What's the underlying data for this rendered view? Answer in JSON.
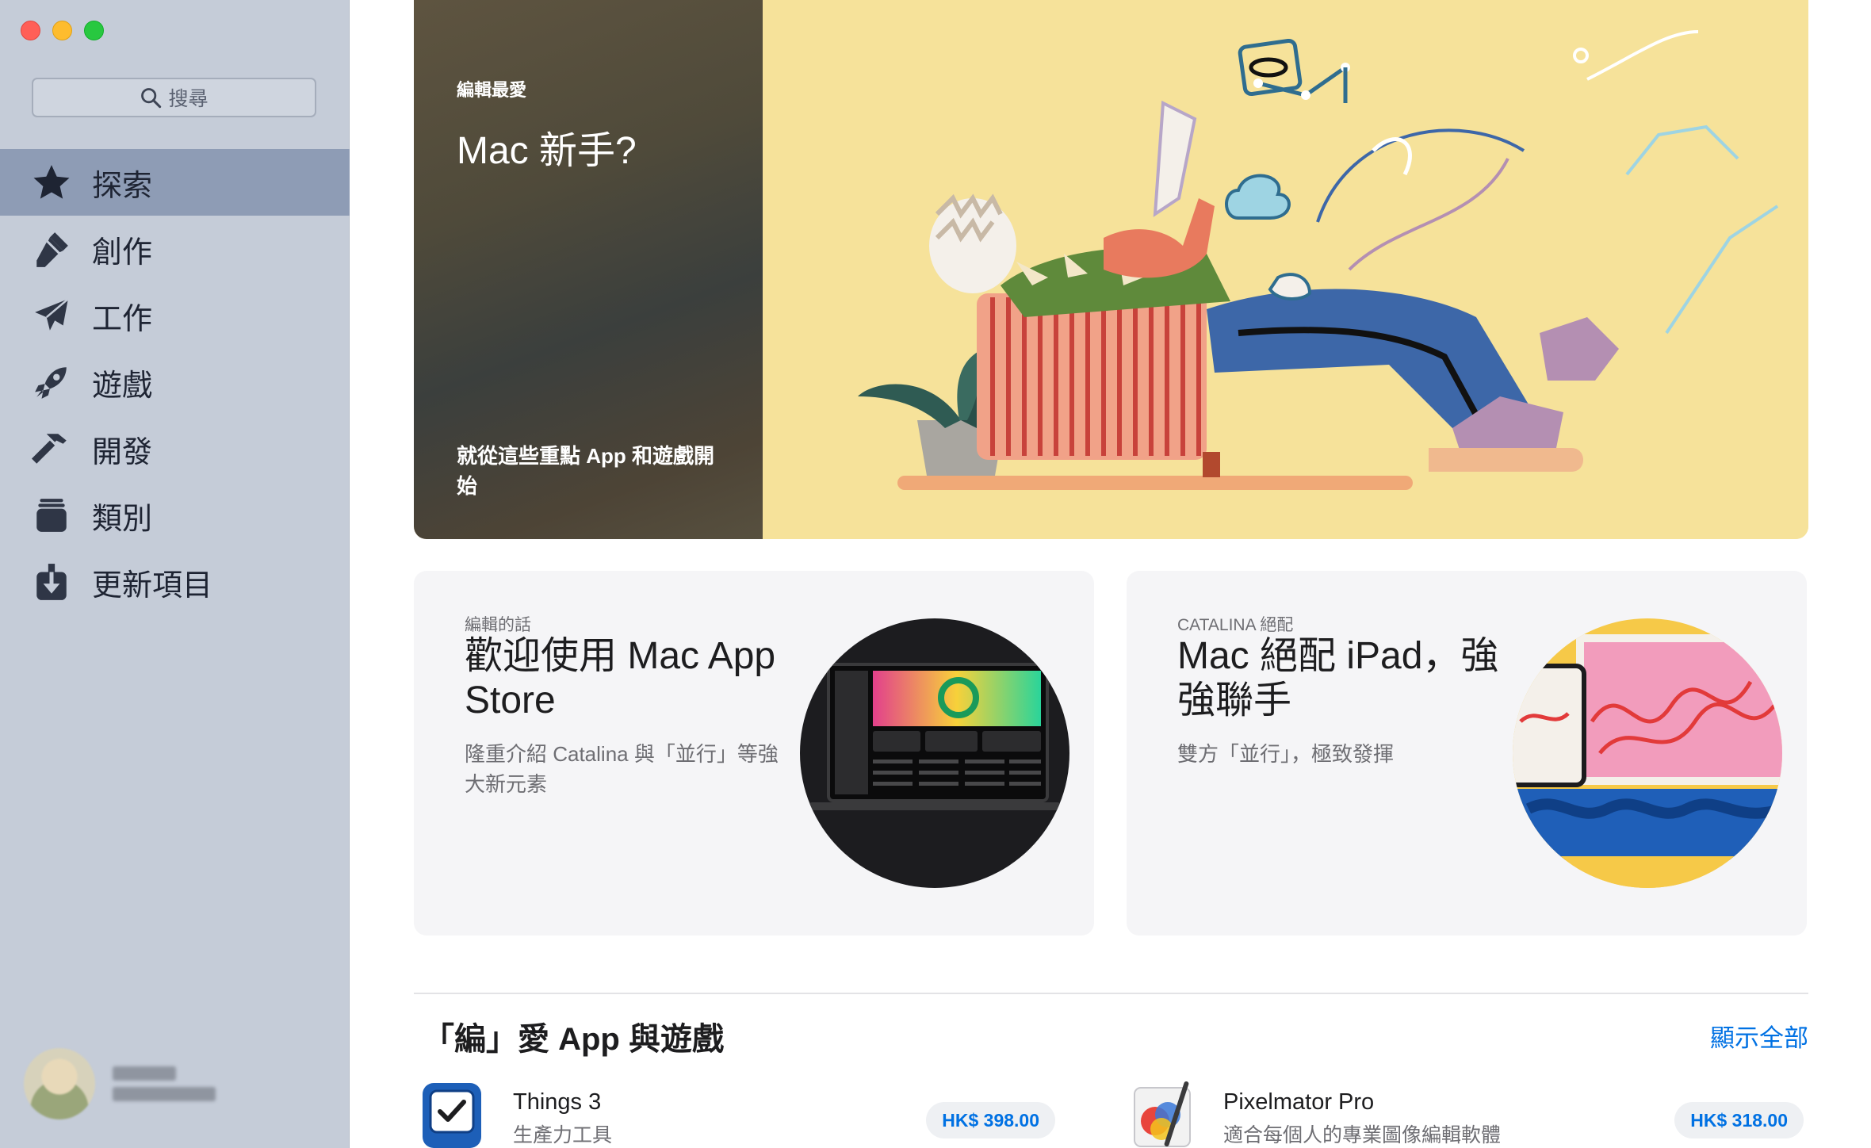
{
  "sidebar": {
    "search_placeholder": "搜尋",
    "items": [
      {
        "label": "探索",
        "icon": "star-icon",
        "active": true
      },
      {
        "label": "創作",
        "icon": "brush-icon"
      },
      {
        "label": "工作",
        "icon": "paper-plane-icon"
      },
      {
        "label": "遊戲",
        "icon": "rocket-icon"
      },
      {
        "label": "開發",
        "icon": "hammer-icon"
      },
      {
        "label": "類別",
        "icon": "category-stack-icon"
      },
      {
        "label": "更新項目",
        "icon": "download-icon"
      }
    ]
  },
  "hero": {
    "eyebrow": "編輯最愛",
    "title": "Mac 新手?",
    "subtitle": "就從這些重點 App 和遊戲開始"
  },
  "cards": [
    {
      "eyebrow": "編輯的話",
      "title": "歡迎使用 Mac App Store",
      "subtitle": "隆重介紹 Catalina 與「並行」等強大新元素"
    },
    {
      "eyebrow": "CATALINA 絕配",
      "title": "Mac 絕配 iPad，強強聯手",
      "subtitle": "雙方「並行」，極致發揮"
    }
  ],
  "section": {
    "title": "「編」愛 App 與遊戲",
    "see_all": "顯示全部"
  },
  "apps": [
    {
      "name": "Things 3",
      "category": "生產力工具",
      "price": "HK$ 398.00"
    },
    {
      "name": "Pixelmator Pro",
      "category": "適合每個人的專業圖像編輯軟體",
      "price": "HK$ 318.00"
    }
  ],
  "colors": {
    "sidebar_bg": "#c5ccd8",
    "sidebar_active": "#8e9cb5",
    "accent_blue": "#0071e3",
    "hero_bg": "#f6e29a"
  }
}
